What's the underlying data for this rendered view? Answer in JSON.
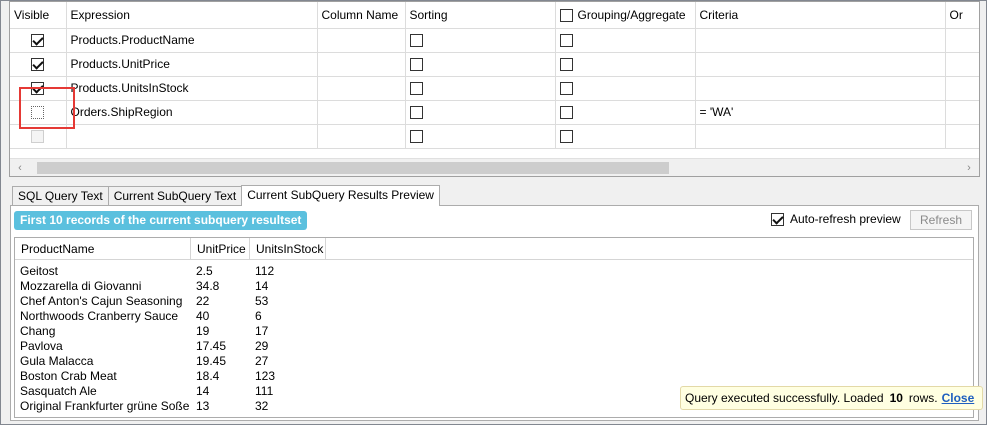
{
  "grid": {
    "headers": [
      "Visible",
      "Expression",
      "Column Name",
      "Sorting",
      "Grouping/Aggregate",
      "Criteria",
      "Or"
    ],
    "rows": [
      {
        "expression": "Products.ProductName",
        "criteria": ""
      },
      {
        "expression": "Products.UnitPrice",
        "criteria": ""
      },
      {
        "expression": "Products.UnitsInStock",
        "criteria": ""
      },
      {
        "expression": "Orders.ShipRegion",
        "criteria": "= 'WA'"
      },
      {
        "expression": "",
        "criteria": ""
      }
    ]
  },
  "scrollbar": {
    "left_arrow": "‹",
    "right_arrow": "›"
  },
  "tabs": [
    "SQL Query Text",
    "Current SubQuery Text",
    "Current SubQuery Results Preview"
  ],
  "preview": {
    "badge": "First 10 records of the current subquery resultset",
    "auto_refresh_label": "Auto-refresh preview",
    "refresh_label": "Refresh"
  },
  "results": {
    "columns": [
      "ProductName",
      "UnitPrice",
      "UnitsInStock"
    ],
    "rows": [
      [
        "Geitost",
        "2.5",
        "112"
      ],
      [
        "Mozzarella di Giovanni",
        "34.8",
        "14"
      ],
      [
        "Chef Anton's Cajun Seasoning",
        "22",
        "53"
      ],
      [
        "Northwoods Cranberry Sauce",
        "40",
        "6"
      ],
      [
        "Chang",
        "19",
        "17"
      ],
      [
        "Pavlova",
        "17.45",
        "29"
      ],
      [
        "Gula Malacca",
        "19.45",
        "27"
      ],
      [
        "Boston Crab Meat",
        "18.4",
        "123"
      ],
      [
        "Sasquatch Ale",
        "14",
        "111"
      ],
      [
        "Original Frankfurter grüne Soße",
        "13",
        "32"
      ]
    ]
  },
  "status": {
    "text_before": "Query executed successfully. Loaded",
    "count": "10",
    "text_after": "rows.",
    "close_label": "Close"
  }
}
